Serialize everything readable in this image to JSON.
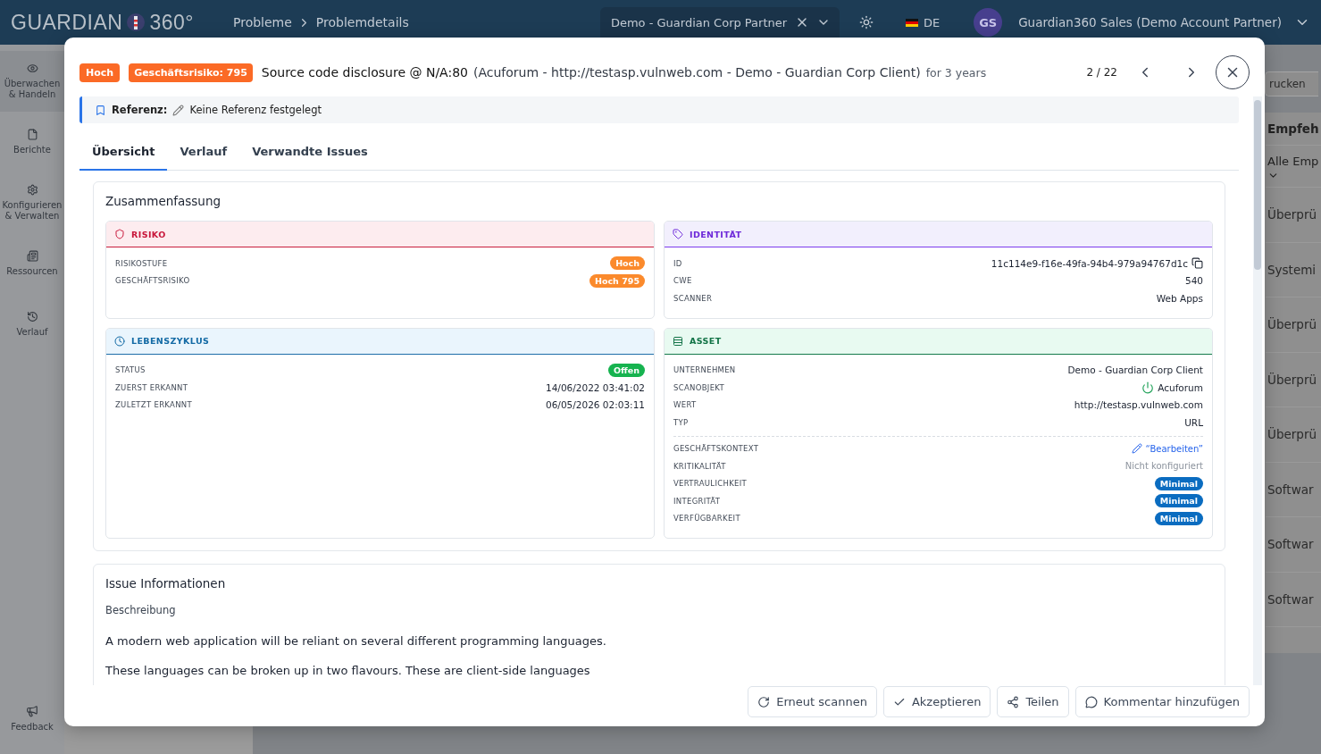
{
  "header": {
    "logo": {
      "word": "GUARDIAN",
      "suffix": "360°"
    },
    "breadcrumbs": [
      "Probleme",
      "Problemdetails"
    ],
    "org_select": {
      "value": "Demo - Guardian Corp Partner"
    },
    "language": "DE",
    "avatar": "GS",
    "user": "Guardian360 Sales (Demo Account Partner)"
  },
  "sidebar": {
    "items": [
      {
        "label": "Überwachen & Handeln",
        "selected": true
      },
      {
        "label": "Berichte",
        "selected": false
      },
      {
        "label": "Konfigurieren & Verwalten",
        "selected": false
      },
      {
        "label": "Ressourcen",
        "selected": false
      },
      {
        "label": "Verlauf",
        "selected": false
      }
    ],
    "feedback": "Feedback"
  },
  "background": {
    "button": "rucken",
    "heading": "Empfeh",
    "filter": "Alle Emp",
    "rows": [
      "Überprü",
      "Systemi",
      "Überprü",
      "Überprü",
      "Überprü",
      "Softwar",
      "Softwar",
      "Softwar"
    ]
  },
  "modal": {
    "badges": [
      {
        "text": "Hoch",
        "kind": "severity"
      },
      {
        "text": "Geschäftsrisiko: 795",
        "kind": "business"
      }
    ],
    "title": "Source code disclosure @ N/A:80",
    "context": "(Acuforum - http://testasp.vulnweb.com - Demo - Guardian Corp Client)",
    "age": "for 3 years",
    "pager": "2 / 22",
    "reference": {
      "label": "Referenz:",
      "value": "Keine Referenz festgelegt"
    },
    "tabs": [
      {
        "label": "Übersicht",
        "selected": true
      },
      {
        "label": "Verlauf",
        "selected": false
      },
      {
        "label": "Verwandte Issues",
        "selected": false
      }
    ],
    "summary": {
      "title": "Zusammenfassung",
      "panels": [
        {
          "kind": "risk",
          "title": "RISIKO",
          "groups": [
            [
              {
                "label": "RISIKOSTUFE",
                "value": "Hoch",
                "kind": "badge",
                "color": "#fb8a2c"
              },
              {
                "label": "GESCHÄFTSRISIKO",
                "value": "Hoch 795",
                "kind": "badge",
                "color": "#fb8a2c"
              }
            ]
          ]
        },
        {
          "kind": "identity",
          "title": "IDENTITÄT",
          "groups": [
            [
              {
                "label": "ID",
                "value": "11c114e9-f16e-49fa-94b4-979a94767d1c",
                "kind": "copy"
              },
              {
                "label": "CWE",
                "value": "540",
                "kind": "text"
              },
              {
                "label": "SCANNER",
                "value": "Web Apps",
                "kind": "text"
              }
            ]
          ]
        },
        {
          "kind": "lifecycle",
          "title": "LEBENSZYKLUS",
          "groups": [
            [
              {
                "label": "STATUS",
                "value": "Offen",
                "kind": "badge",
                "color": "#16b34f"
              },
              {
                "label": "ZUERST ERKANNT",
                "value": "14/06/2022 03:41:02",
                "kind": "text"
              },
              {
                "label": "ZULETZT ERKANNT",
                "value": "06/05/2026 02:03:11",
                "kind": "text"
              }
            ]
          ]
        },
        {
          "kind": "asset",
          "title": "ASSET",
          "groups": [
            [
              {
                "label": "UNTERNEHMEN",
                "value": "Demo - Guardian Corp Client",
                "kind": "text"
              },
              {
                "label": "SCANOBJEKT",
                "value": "Acuforum",
                "kind": "scan-object"
              },
              {
                "label": "WERT",
                "value": "http://testasp.vulnweb.com",
                "kind": "text"
              },
              {
                "label": "TYP",
                "value": "URL",
                "kind": "text"
              }
            ],
            [
              {
                "label": "GESCHÄFTSKONTEXT",
                "value": "“Bearbeiten”",
                "kind": "edit-link"
              },
              {
                "label": "KRITIKALITÄT",
                "value": "Nicht konfiguriert",
                "kind": "muted"
              },
              {
                "label": "VERTRAULICHKEIT",
                "value": "Minimal",
                "kind": "badge",
                "color": "#0a6cc0"
              },
              {
                "label": "INTEGRITÄT",
                "value": "Minimal",
                "kind": "badge",
                "color": "#0a6cc0"
              },
              {
                "label": "VERFÜGBARKEIT",
                "value": "Minimal",
                "kind": "badge",
                "color": "#0a6cc0"
              }
            ]
          ]
        }
      ]
    },
    "issue": {
      "title": "Issue Informationen",
      "subtitle": "Beschreibung",
      "paragraphs": [
        "A modern web application will be reliant on several different programming languages.",
        "These languages can be broken up in two flavours. These are client-side languages"
      ]
    },
    "actions": [
      {
        "label": "Erneut scannen",
        "kind": "rescan"
      },
      {
        "label": "Akzeptieren",
        "kind": "accept"
      },
      {
        "label": "Teilen",
        "kind": "share"
      },
      {
        "label": "Kommentar hinzufügen",
        "kind": "comment"
      }
    ]
  }
}
